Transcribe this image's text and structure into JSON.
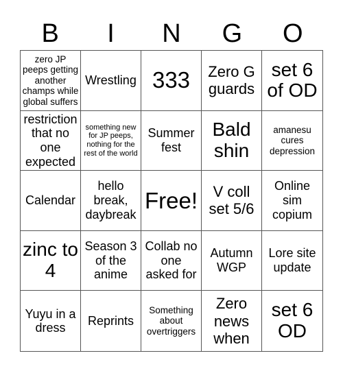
{
  "header": [
    "B",
    "I",
    "N",
    "G",
    "O"
  ],
  "cells": [
    {
      "text": "zero JP peeps getting another champs while global suffers",
      "size": "s-sm"
    },
    {
      "text": "Wrestling",
      "size": "s-md"
    },
    {
      "text": "333",
      "size": "s-xxl"
    },
    {
      "text": "Zero G guards",
      "size": "s-lg"
    },
    {
      "text": "set 6 of OD",
      "size": "s-xl"
    },
    {
      "text": "restriction that no one expected",
      "size": "s-md"
    },
    {
      "text": "something new for JP peeps, nothing for the rest of the world",
      "size": "s-xs"
    },
    {
      "text": "Summer fest",
      "size": "s-md"
    },
    {
      "text": "Bald shin",
      "size": "s-xl"
    },
    {
      "text": "amanesu cures depression",
      "size": "s-sm"
    },
    {
      "text": "Calendar",
      "size": "s-md"
    },
    {
      "text": "hello break, daybreak",
      "size": "s-md"
    },
    {
      "text": "Free!",
      "size": "s-xxl"
    },
    {
      "text": "V coll set 5/6",
      "size": "s-lg"
    },
    {
      "text": "Online sim copium",
      "size": "s-md"
    },
    {
      "text": "zinc to 4",
      "size": "s-xl"
    },
    {
      "text": "Season 3 of the anime",
      "size": "s-md"
    },
    {
      "text": "Collab no one asked for",
      "size": "s-md"
    },
    {
      "text": "Autumn WGP",
      "size": "s-md"
    },
    {
      "text": "Lore site update",
      "size": "s-md"
    },
    {
      "text": "Yuyu in a dress",
      "size": "s-md"
    },
    {
      "text": "Reprints",
      "size": "s-md"
    },
    {
      "text": "Something about overtriggers",
      "size": "s-sm"
    },
    {
      "text": "Zero news when",
      "size": "s-lg"
    },
    {
      "text": "set 6 OD",
      "size": "s-xl"
    }
  ]
}
